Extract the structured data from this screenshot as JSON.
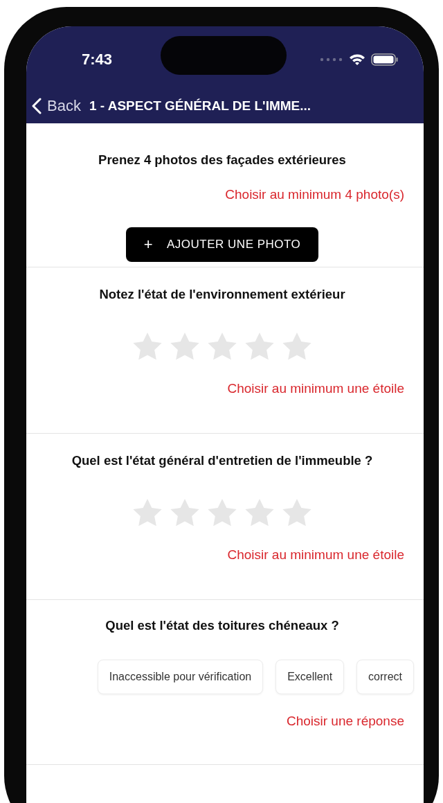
{
  "status_bar": {
    "time": "7:43"
  },
  "nav_bar": {
    "back": "Back",
    "title": "1 - ASPECT GÉNÉRAL DE L'IMME..."
  },
  "questions": [
    {
      "kind": "photo",
      "title": "Prenez 4 photos des façades extérieures",
      "hint": "Choisir au minimum 4 photo(s)",
      "button": {
        "icon": "+",
        "label": "AJOUTER UNE PHOTO"
      }
    },
    {
      "kind": "stars",
      "title": "Notez l'état de l'environnement extérieur",
      "stars": 0,
      "hint": "Choisir au minimum une étoile"
    },
    {
      "kind": "stars",
      "title": "Quel est l'état général d'entretien de l'immeuble ?",
      "stars": 0,
      "hint": "Choisir au minimum une étoile"
    },
    {
      "kind": "choices",
      "title": "Quel est l'état des toitures chéneaux ?",
      "options": [
        {
          "label": "Inaccessible pour vérification",
          "selected": false
        },
        {
          "label": "Excellent",
          "selected": false
        },
        {
          "label": "correct",
          "selected": false
        }
      ],
      "hint": "Choisir une réponse"
    }
  ]
}
